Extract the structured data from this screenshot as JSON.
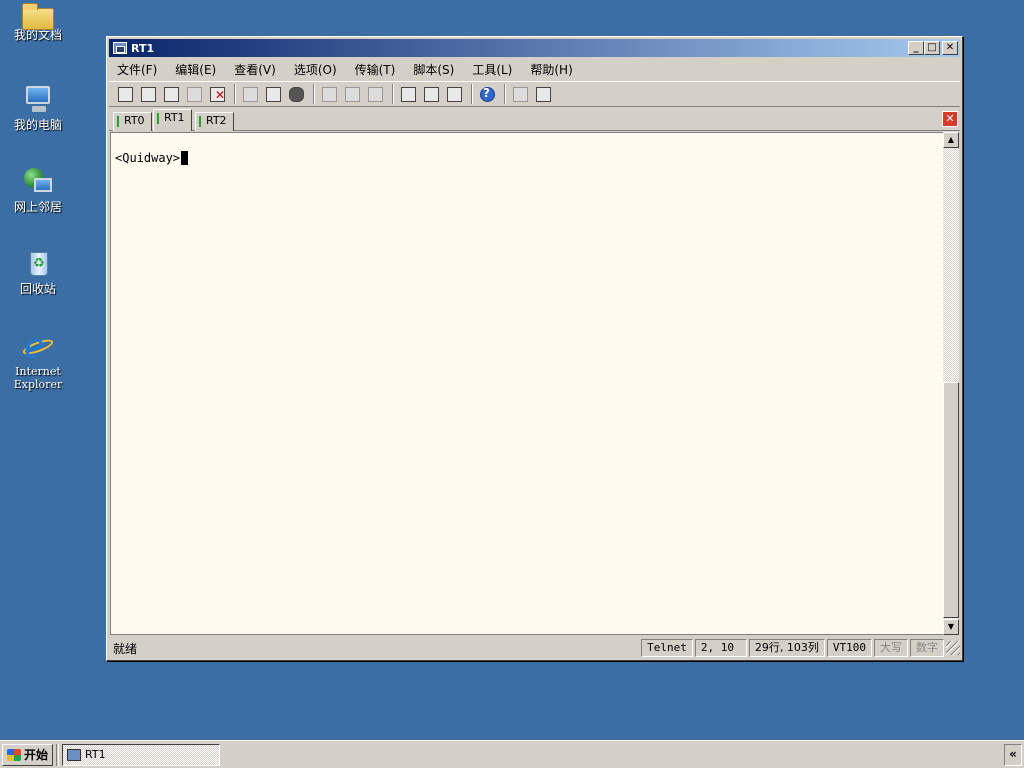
{
  "desktop": {
    "icons": [
      {
        "label": "我的文档"
      },
      {
        "label": "我的电脑"
      },
      {
        "label": "网上邻居"
      },
      {
        "label": "回收站"
      },
      {
        "label": "Internet Explorer"
      }
    ]
  },
  "window": {
    "title": "RT1",
    "menu": [
      "文件(F)",
      "编辑(E)",
      "查看(V)",
      "选项(O)",
      "传输(T)",
      "脚本(S)",
      "工具(L)",
      "帮助(H)"
    ],
    "tabs": [
      "RT0",
      "RT1",
      "RT2"
    ],
    "active_tab": "RT1"
  },
  "terminal": {
    "prompt": "<Quidway>"
  },
  "status": {
    "ready": "就绪",
    "protocol": "Telnet",
    "cursor_pos": "2,  10",
    "size": "29行, 103列",
    "emulation": "VT100",
    "caps": "大写",
    "num": "数字"
  },
  "taskbar": {
    "start": "开始",
    "task_label": "RT1",
    "tray_chevron": "«"
  }
}
